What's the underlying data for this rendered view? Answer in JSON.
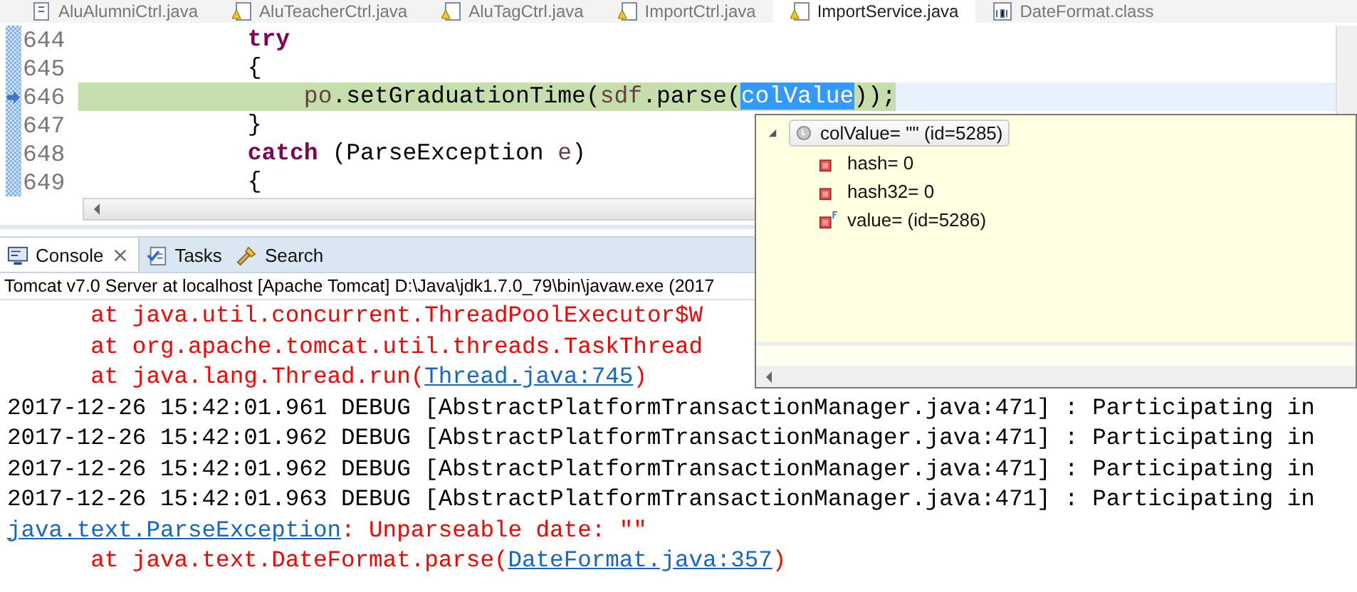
{
  "editor_tabs": [
    {
      "label": "AluAlumniCtrl.java",
      "kind": "java",
      "selected": false
    },
    {
      "label": "AluTeacherCtrl.java",
      "kind": "java_warning",
      "selected": false
    },
    {
      "label": "AluTagCtrl.java",
      "kind": "java_warning",
      "selected": false
    },
    {
      "label": "ImportCtrl.java",
      "kind": "java_warning",
      "selected": false
    },
    {
      "label": "ImportService.java",
      "kind": "java_warning",
      "selected": true
    },
    {
      "label": "DateFormat.class",
      "kind": "class",
      "selected": false
    }
  ],
  "code_lines": [
    {
      "number": "644",
      "current": false,
      "tokens": [
        {
          "text": "            try",
          "kind": "keyword"
        }
      ]
    },
    {
      "number": "645",
      "current": false,
      "tokens": [
        {
          "text": "            {",
          "kind": "plain"
        }
      ]
    },
    {
      "number": "646",
      "current": true,
      "tokens": [
        {
          "text": "                po",
          "kind": "variable"
        },
        {
          "text": ".setGraduationTime(",
          "kind": "plain"
        },
        {
          "text": "sdf",
          "kind": "variable"
        },
        {
          "text": ".parse(",
          "kind": "plain"
        },
        {
          "text": "colValue",
          "kind": "selected"
        },
        {
          "text": "));",
          "kind": "plain"
        }
      ]
    },
    {
      "number": "647",
      "current": false,
      "tokens": [
        {
          "text": "            }",
          "kind": "plain"
        }
      ]
    },
    {
      "number": "648",
      "current": false,
      "tokens": [
        {
          "text": "            catch",
          "kind": "keyword"
        },
        {
          "text": " (ParseException ",
          "kind": "plain"
        },
        {
          "text": "e",
          "kind": "variable"
        },
        {
          "text": ")",
          "kind": "plain"
        }
      ]
    },
    {
      "number": "649",
      "current": false,
      "tokens": [
        {
          "text": "            {",
          "kind": "plain"
        }
      ]
    }
  ],
  "bottom_tabs": [
    {
      "label": "Console",
      "kind": "console",
      "selected": true,
      "closable": true
    },
    {
      "label": "Tasks",
      "kind": "tasks",
      "selected": false,
      "closable": false
    },
    {
      "label": "Search",
      "kind": "search",
      "selected": false,
      "closable": false
    }
  ],
  "console": {
    "title": "Tomcat v7.0 Server at localhost [Apache Tomcat] D:\\Java\\jdk1.7.0_79\\bin\\javaw.exe (2017",
    "lines": [
      [
        {
          "text": "\tat java.util.concurrent.ThreadPoolExecutor$W",
          "kind": "error"
        }
      ],
      [
        {
          "text": "\tat org.apache.tomcat.util.threads.TaskThread",
          "kind": "error"
        }
      ],
      [
        {
          "text": "\tat java.lang.Thread.run(",
          "kind": "error"
        },
        {
          "text": "Thread.java:745",
          "kind": "link"
        },
        {
          "text": ")",
          "kind": "error"
        }
      ],
      [
        {
          "text": "2017-12-26 15:42:01.961 DEBUG [AbstractPlatformTransactionManager.java:471] : Participating in",
          "kind": "plain"
        }
      ],
      [
        {
          "text": "2017-12-26 15:42:01.962 DEBUG [AbstractPlatformTransactionManager.java:471] : Participating in",
          "kind": "plain"
        }
      ],
      [
        {
          "text": "2017-12-26 15:42:01.962 DEBUG [AbstractPlatformTransactionManager.java:471] : Participating in",
          "kind": "plain"
        }
      ],
      [
        {
          "text": "2017-12-26 15:42:01.963 DEBUG [AbstractPlatformTransactionManager.java:471] : Participating in",
          "kind": "plain"
        }
      ],
      [
        {
          "text": "java.text.ParseException",
          "kind": "link"
        },
        {
          "text": ": Unparseable date: \"\"",
          "kind": "error"
        }
      ],
      [
        {
          "text": "\tat java.text.DateFormat.parse(",
          "kind": "error"
        },
        {
          "text": "DateFormat.java:357",
          "kind": "link"
        },
        {
          "text": ")",
          "kind": "error"
        }
      ]
    ]
  },
  "inspect_popup": {
    "root": {
      "label": "colValue= \"\" (id=5285)",
      "expanded": true,
      "children": [
        {
          "label": "hash= 0",
          "final": false
        },
        {
          "label": "hash32= 0",
          "final": false
        },
        {
          "label": "value= (id=5286)",
          "final": true
        }
      ]
    }
  }
}
